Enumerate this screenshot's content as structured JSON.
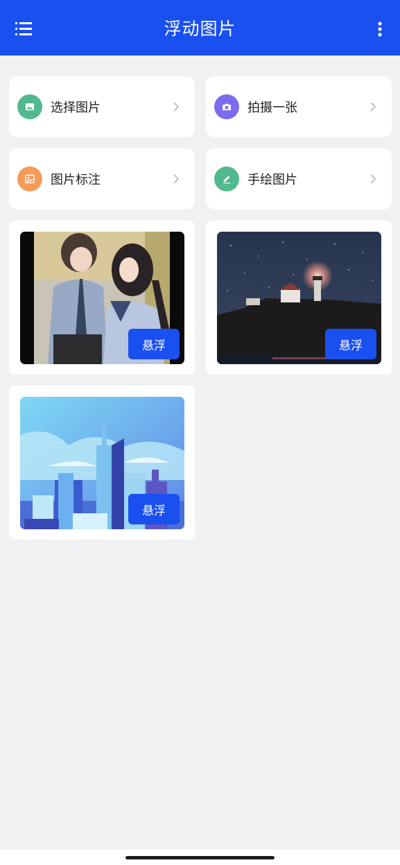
{
  "header": {
    "title": "浮动图片",
    "menu_icon": "list-menu-icon",
    "more_icon": "vertical-dots-icon",
    "background": "#1a4ff0"
  },
  "actions": [
    {
      "label": "选择图片",
      "icon": "image-icon",
      "color": "#52b98e"
    },
    {
      "label": "拍摄一张",
      "icon": "camera-icon",
      "color": "#7b6cf0"
    },
    {
      "label": "图片标注",
      "icon": "annotate-image-icon",
      "color": "#f59a57"
    },
    {
      "label": "手绘图片",
      "icon": "pen-icon",
      "color": "#52b98e"
    }
  ],
  "images": [
    {
      "subject": "anime-couple",
      "button_label": "悬浮"
    },
    {
      "subject": "lighthouse-at-night",
      "button_label": "悬浮"
    },
    {
      "subject": "city-skyline-illustration",
      "button_label": "悬浮"
    }
  ]
}
